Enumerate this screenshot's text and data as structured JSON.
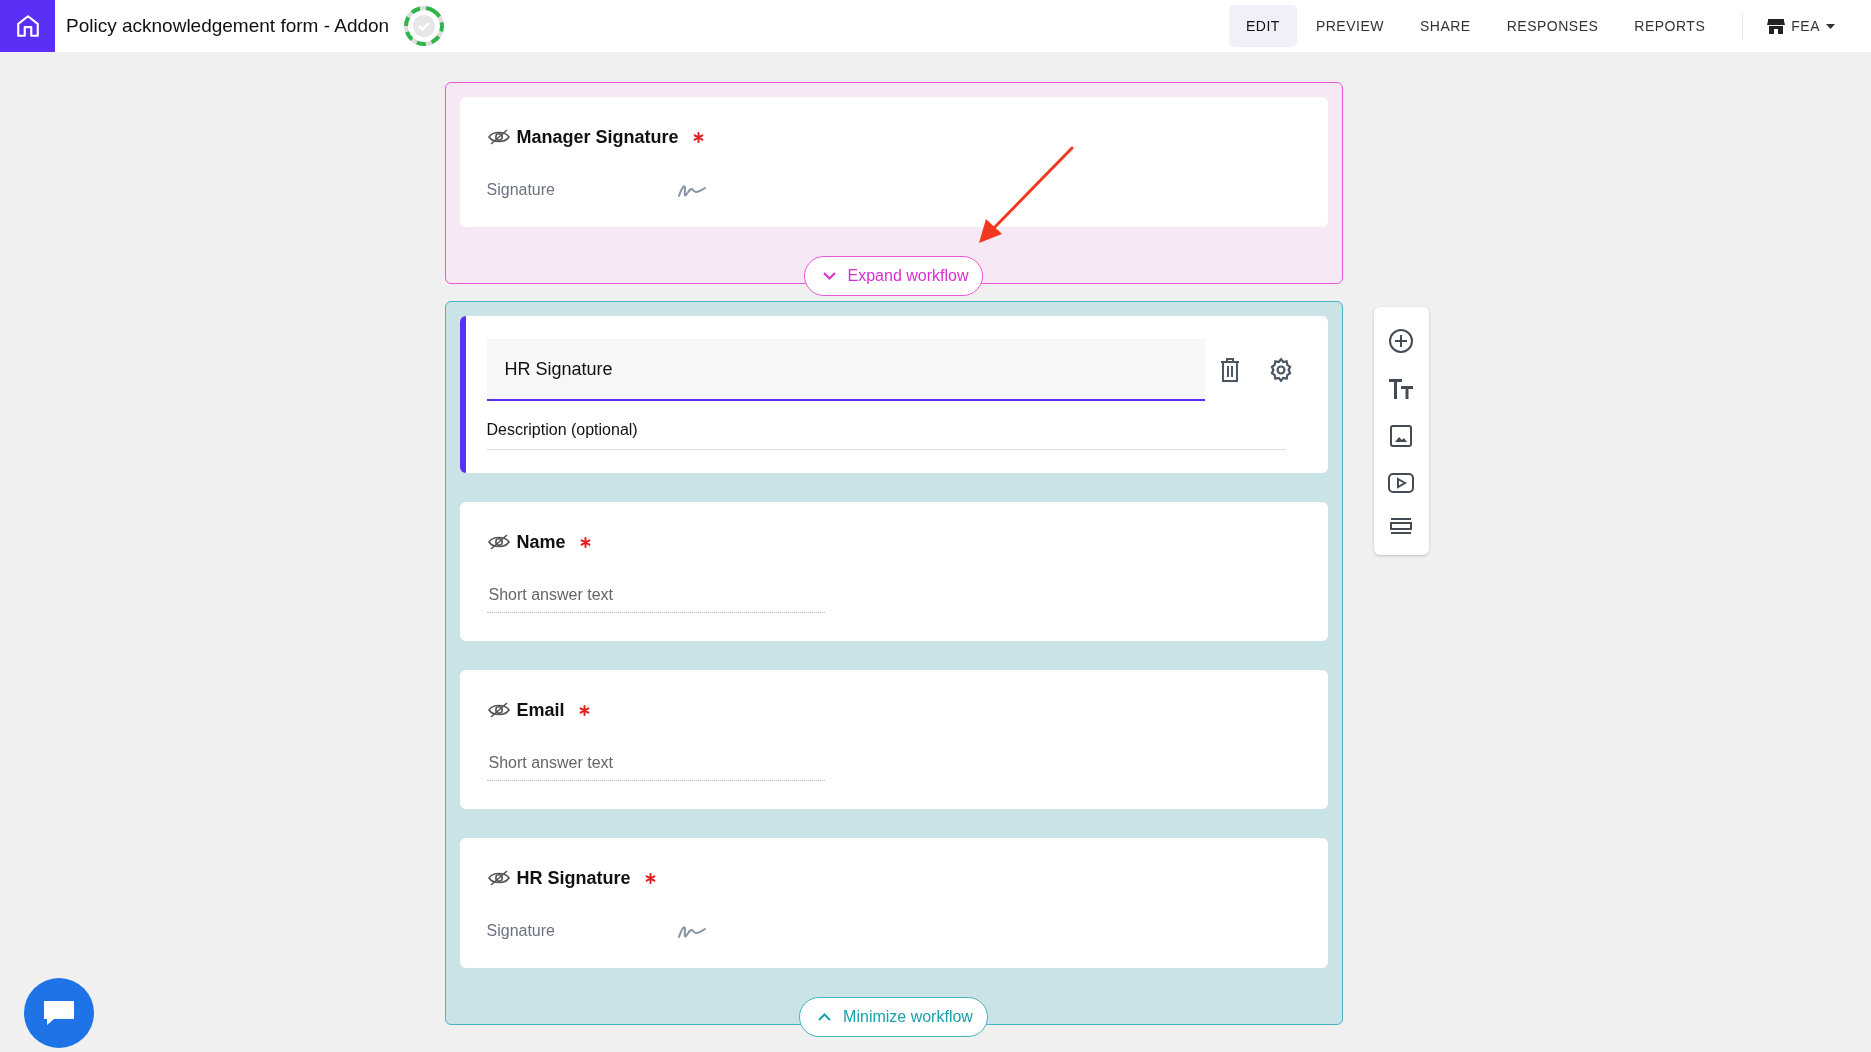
{
  "app": {
    "title": "Policy acknowledgement form - Addon",
    "saved": true
  },
  "nav": {
    "tabs": [
      {
        "label": "EDIT",
        "selected": true
      },
      {
        "label": "PREVIEW",
        "selected": false
      },
      {
        "label": "SHARE",
        "selected": false
      },
      {
        "label": "RESPONSES",
        "selected": false
      },
      {
        "label": "REPORTS",
        "selected": false
      }
    ],
    "workspace": "FEA"
  },
  "sections": [
    {
      "kind": "collapsed",
      "toggle": {
        "label": "Expand workflow",
        "expanded": false
      },
      "items": [
        {
          "kind": "signature",
          "title": "Manager Signature",
          "required": true,
          "hidden": true,
          "field_label": "Signature"
        }
      ]
    },
    {
      "kind": "expanded",
      "toggle": {
        "label": "Minimize workflow",
        "expanded": true
      },
      "items": [
        {
          "kind": "editor",
          "title_value": "HR Signature",
          "description_placeholder": "Description (optional)"
        },
        {
          "kind": "short_answer",
          "title": "Name",
          "required": true,
          "hidden": true,
          "placeholder": "Short answer text"
        },
        {
          "kind": "short_answer",
          "title": "Email",
          "required": true,
          "hidden": true,
          "placeholder": "Short answer text"
        },
        {
          "kind": "signature",
          "title": "HR Signature",
          "required": true,
          "hidden": true,
          "field_label": "Signature"
        }
      ]
    }
  ]
}
